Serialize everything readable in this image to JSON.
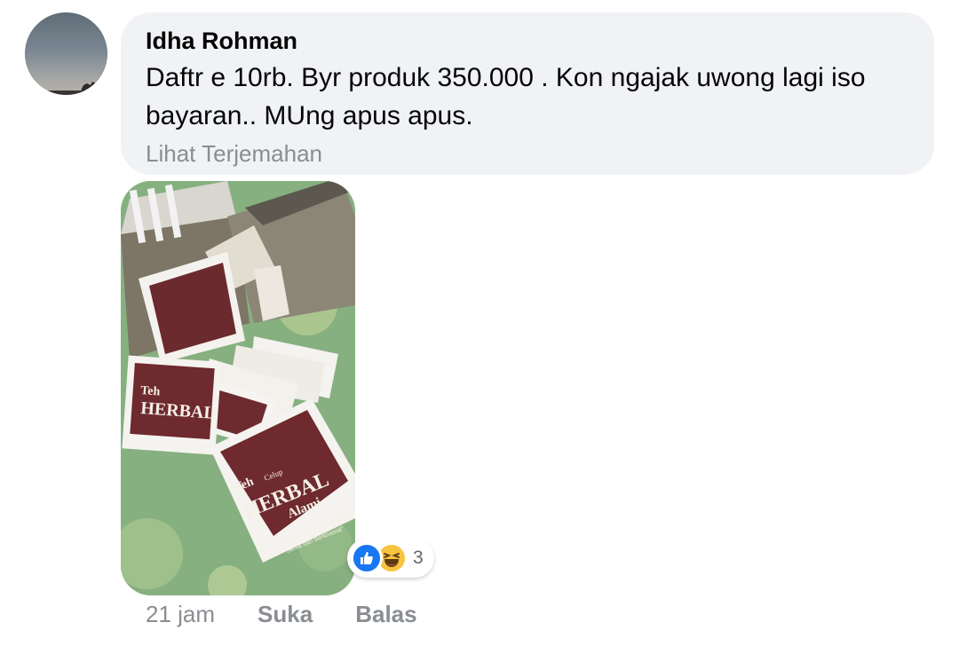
{
  "comment": {
    "author": "Idha Rohman",
    "text": "Daftr e 10rb.  Byr produk 350.000 . Kon ngajak uwong lagi iso bayaran.. MUng apus apus.",
    "translate_label": "Lihat Terjemahan"
  },
  "photo": {
    "product_brand": "Teh",
    "product_sub": "Celup",
    "product_name_1": "HERBAL",
    "product_name_2": "Alami",
    "product_tagline_1": "Minuman Keluarga Indonesia",
    "product_tagline_2": "\"Sehat dan Berkhasiat\""
  },
  "reactions": {
    "icons": [
      "like-icon",
      "haha-icon"
    ],
    "count": "3",
    "colors": {
      "like": "#1877f2",
      "haha": "#f7c440"
    }
  },
  "actions": {
    "time": "21 jam",
    "like_label": "Suka",
    "reply_label": "Balas"
  }
}
